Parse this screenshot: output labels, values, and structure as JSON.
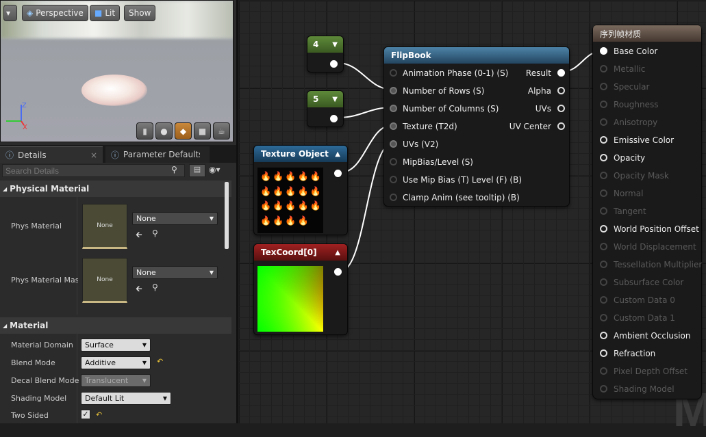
{
  "viewport": {
    "menu_icon": "chevron-down-icon",
    "perspective": "Perspective",
    "lit": "Lit",
    "show": "Show",
    "axis_z": "Z",
    "axis_x": "X"
  },
  "tabs": {
    "details": "Details",
    "params": "Parameter Defaults"
  },
  "search": {
    "placeholder": "Search Details"
  },
  "physical_material": {
    "category": "Physical Material",
    "phys_material_label": "Phys Material",
    "phys_material_thumb": "None",
    "phys_material_value": "None",
    "phys_mask_label": "Phys Material Mask",
    "phys_mask_thumb": "None",
    "phys_mask_value": "None"
  },
  "material": {
    "category": "Material",
    "rows": [
      {
        "label": "Material Domain",
        "value": "Surface"
      },
      {
        "label": "Blend Mode",
        "value": "Additive"
      },
      {
        "label": "Decal Blend Mode",
        "value": "Translucent"
      },
      {
        "label": "Shading Model",
        "value": "Default Lit"
      },
      {
        "label": "Two Sided",
        "value": "checked"
      }
    ]
  },
  "nodes": {
    "const4": "4",
    "const5": "5",
    "texobj": "Texture Object",
    "texcoord": "TexCoord[0]",
    "flipbook": {
      "title": "FlipBook",
      "inputs": [
        "Animation  Phase (0-1) (S)",
        "Number of Rows (S)",
        "Number of Columns (S)",
        "Texture (T2d)",
        "UVs (V2)",
        "MipBias/Level (S)",
        "Use Mip Bias (T) Level (F) (B)",
        "Clamp Anim (see tooltip) (B)"
      ],
      "outputs": [
        "Result",
        "Alpha",
        "UVs",
        "UV Center"
      ]
    },
    "material": {
      "title": "序列帧材质",
      "inputs": [
        "Base Color",
        "Metallic",
        "Specular",
        "Roughness",
        "Anisotropy",
        "Emissive Color",
        "Opacity",
        "Opacity Mask",
        "Normal",
        "Tangent",
        "World Position Offset",
        "World Displacement",
        "Tessellation Multiplier",
        "Subsurface Color",
        "Custom Data 0",
        "Custom Data 1",
        "Ambient Occlusion",
        "Refraction",
        "Pixel Depth Offset",
        "Shading Model"
      ],
      "enabled": [
        true,
        false,
        false,
        false,
        false,
        true,
        true,
        false,
        false,
        false,
        true,
        false,
        false,
        false,
        false,
        false,
        true,
        true,
        false,
        false
      ]
    }
  },
  "colors": {
    "const_header": "#4a6b2a",
    "texobj_header": "#1f4e73",
    "texcoord_header": "#7a1a1a",
    "flipbook_header": "#3f6f8f",
    "material_header": "#5a4a3e"
  }
}
